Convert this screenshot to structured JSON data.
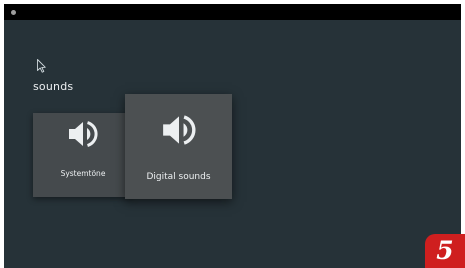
{
  "section": {
    "title": "sounds"
  },
  "cards": [
    {
      "label": "Systemtöne",
      "icon": "speaker-icon"
    },
    {
      "label": "Digital sounds",
      "icon": "speaker-icon"
    }
  ],
  "badge": {
    "text": "5"
  },
  "colors": {
    "background": "#263238",
    "status_bar": "#000000",
    "card": "#474b4d",
    "card_focused": "#4c5052",
    "text": "#eceff1",
    "badge": "#cf1f1f"
  }
}
